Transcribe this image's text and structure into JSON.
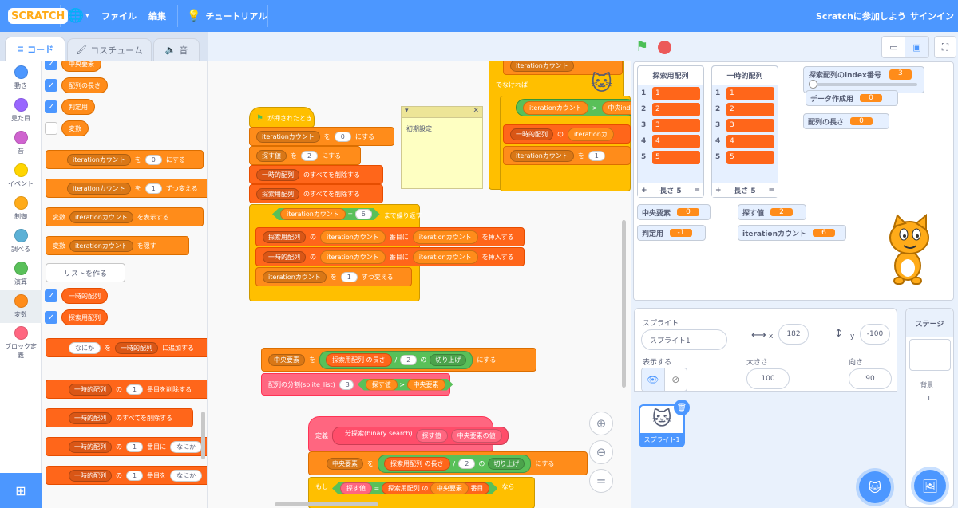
{
  "menu": {
    "logo": "SCRATCH",
    "file": "ファイル",
    "edit": "編集",
    "tutorial": "チュートリアル",
    "join": "Scratchに参加しよう",
    "signin": "サインイン"
  },
  "tabs": {
    "code": "コード",
    "costume": "コスチューム",
    "sound": "音"
  },
  "categories": [
    {
      "label": "動き",
      "color": "#4c97ff"
    },
    {
      "label": "見た目",
      "color": "#9966ff"
    },
    {
      "label": "音",
      "color": "#cf63cf"
    },
    {
      "label": "イベント",
      "color": "#ffd500"
    },
    {
      "label": "制御",
      "color": "#ffab19"
    },
    {
      "label": "調べる",
      "color": "#5cb1d6"
    },
    {
      "label": "演算",
      "color": "#59c059"
    },
    {
      "label": "変数",
      "color": "#ff8c1a"
    },
    {
      "label": "ブロック定義",
      "color": "#ff6680"
    }
  ],
  "palette": {
    "vars": [
      "中央要素",
      "配列の長さ",
      "判定用",
      "変数"
    ],
    "set_pre": "iterationカウント",
    "set_to": "を",
    "set_val": "0",
    "set_suffix": "にする",
    "change_val": "1",
    "change_suffix": "ずつ変える",
    "show_pre": "変数",
    "show_suffix": "を表示する",
    "hide_suffix": "を隠す",
    "make_list": "リストを作る",
    "lists": [
      "一時的配列",
      "探索用配列"
    ],
    "add_item": "なにか",
    "add_to": "を",
    "add_list": "一時的配列",
    "add_suffix": "に追加する",
    "del_list": "一時的配列",
    "del_of": "の",
    "del_idx": "1",
    "del_suffix": "番目を削除する",
    "delall_suffix": "のすべてを削除する",
    "ins_suffix": "番目に",
    "ins_item": "なにか",
    "rep_suffix": "番目を",
    "rep_item": "なにか"
  },
  "script": {
    "hat": "が押されたとき",
    "var_iter": "iterationカウント",
    "set_to": "を",
    "zero": "0",
    "set_suffix": "にする",
    "var_search": "探す値",
    "two": "2",
    "list_temp": "一時的配列",
    "list_search": "探索用配列",
    "delall": "のすべてを削除する",
    "repeat_val": "6",
    "repeat_suffix": "まで繰り返す",
    "eq": "=",
    "of": "の",
    "idx_mid": "番目に",
    "insert_suffix": "を挿入する",
    "change_one": "1",
    "change_suffix": "ずつ変える",
    "note_title": "初期設定",
    "var_mid": "中央要素",
    "length": "の長さ",
    "div": "/",
    "ceil": "切り上げ",
    "split_call": "配列の分割(splite_list)",
    "three": "3",
    "gt": ">",
    "define": "定義",
    "define_name": "二分探索(binary search)",
    "param1": "探す値",
    "param2": "中央要素の値",
    "if": "もし",
    "nth": "番目",
    "then": "なら",
    "top_else": "でなければ",
    "top_iter": "iterationカウント",
    "top_gt": ">",
    "top_mid": "中央inde",
    "top_one": "1",
    "top_temp": "一時的配列",
    "top_of": "の",
    "top_iter2": "iterationカ"
  },
  "stage": {
    "list1": {
      "title": "探索用配列",
      "items": [
        "1",
        "2",
        "3",
        "4",
        "5"
      ],
      "length": "長さ 5",
      "plus": "+",
      "eq": "="
    },
    "list2": {
      "title": "一時的配列",
      "items": [
        "1",
        "2",
        "3",
        "4",
        "5"
      ],
      "length": "長さ 5",
      "plus": "+",
      "eq": "="
    },
    "slider": {
      "label": "探索配列のindex番号",
      "value": "3"
    },
    "monitors": {
      "data_flag": {
        "label": "データ作成用",
        "value": "0"
      },
      "arr_len": {
        "label": "配列の長さ",
        "value": "0"
      },
      "mid": {
        "label": "中央要素",
        "value": "0"
      },
      "judge": {
        "label": "判定用",
        "value": "-1"
      },
      "search": {
        "label": "探す値",
        "value": "2"
      },
      "iter": {
        "label": "iterationカウント",
        "value": "6"
      }
    }
  },
  "sprite_info": {
    "sprite_label": "スプライト",
    "name": "スプライト1",
    "x_label": "x",
    "x": "182",
    "y_label": "y",
    "y": "-100",
    "show_label": "表示する",
    "size_label": "大きさ",
    "size": "100",
    "dir_label": "向き",
    "dir": "90",
    "thumb_name": "スプライト1"
  },
  "stage_pane": {
    "title": "ステージ",
    "bg_label": "背景",
    "bg_count": "1"
  }
}
